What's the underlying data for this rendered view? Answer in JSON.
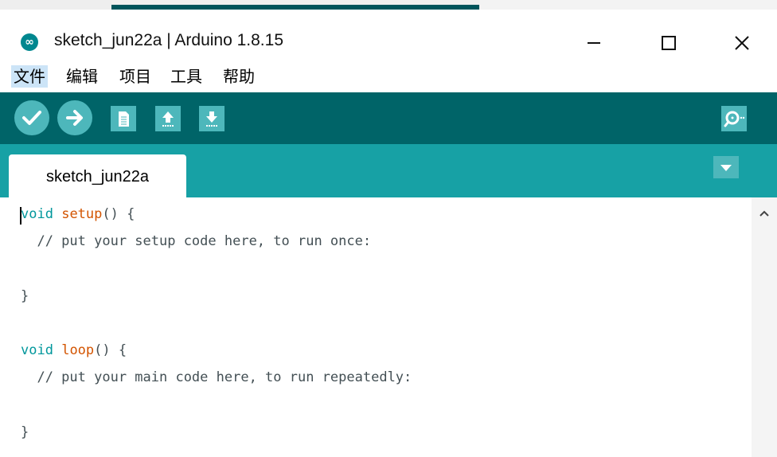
{
  "window": {
    "title": "sketch_jun22a | Arduino 1.8.15",
    "app_icon": "arduino-infinity-icon",
    "controls": [
      "minimize-icon",
      "maximize-icon",
      "close-icon"
    ]
  },
  "menu": {
    "items": [
      "文件",
      "编辑",
      "项目",
      "工具",
      "帮助"
    ]
  },
  "toolbar": {
    "buttons": [
      "verify-icon",
      "upload-icon",
      "new-icon",
      "open-icon",
      "save-icon"
    ],
    "serial_monitor": "serial-monitor-icon"
  },
  "tabs": {
    "items": [
      "sketch_jun22a"
    ],
    "menu_icon": "tab-menu-icon"
  },
  "editor": {
    "lines": [
      {
        "kw": "void",
        "fn": "setup",
        "rest": "() {"
      },
      {
        "text": "  // put your setup code here, to run once:"
      },
      {
        "text": ""
      },
      {
        "text": "}"
      },
      {
        "text": ""
      },
      {
        "kw": "void",
        "fn": "loop",
        "rest": "() {"
      },
      {
        "text": "  // put your main code here, to run repeatedly:"
      },
      {
        "text": ""
      },
      {
        "text": "}"
      }
    ]
  },
  "colors": {
    "toolbar": "#006468",
    "tabbar": "#17a1a5",
    "button": "#4db7bb",
    "keyword": "#00979c",
    "function": "#d35400"
  }
}
